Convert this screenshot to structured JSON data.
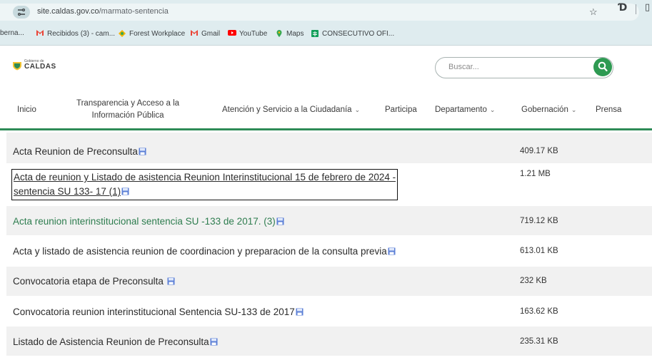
{
  "browser": {
    "url_host": "site.caldas.gov.co",
    "url_path": "/marmato-sentencia",
    "bookmarks": [
      {
        "label": "berna...",
        "icon": "none-icon"
      },
      {
        "label": "Recibidos (3) - cam...",
        "icon": "gmail-icon"
      },
      {
        "label": "Forest Workplace",
        "icon": "forest-icon"
      },
      {
        "label": "Gmail",
        "icon": "gmail-icon"
      },
      {
        "label": "YouTube",
        "icon": "youtube-icon"
      },
      {
        "label": "Maps",
        "icon": "maps-icon"
      },
      {
        "label": "CONSECUTIVO OFI...",
        "icon": "sheets-icon"
      }
    ]
  },
  "header": {
    "logo_small": "Gobierno de",
    "logo_big": "CALDAS",
    "search_placeholder": "Buscar..."
  },
  "nav": {
    "inicio": "Inicio",
    "transparencia_line1": "Transparencia y Acceso a la",
    "transparencia_line2": "Información Pública",
    "atencion": "Atención y Servicio a la Ciudadanía",
    "participa": "Participa",
    "departamento": "Departamento",
    "gobernacion": "Gobernación",
    "prensa": "Prensa"
  },
  "documents": [
    {
      "title": "Acta Reunion de Preconsulta",
      "size": "409.17 KB"
    },
    {
      "title_line1": "Acta de reunion y Listado de asistencia Reunion Interinstitucional 15 de febrero de 2024 -",
      "title_line2": "sentencia SU 133- 17 (1)",
      "size": "1.21 MB"
    },
    {
      "title": "Acta reunion interinstitucional sentencia SU -133 de 2017. (3)",
      "size": "719.12 KB"
    },
    {
      "title": "Acta y listado de asistencia reunion de coordinacion y preparacion de la consulta previa",
      "size": "613.01 KB"
    },
    {
      "title": "Convocatoria etapa de Preconsulta ",
      "size": "232 KB"
    },
    {
      "title": "Convocatoria reunion interinstitucional Sentencia SU-133 de 2017",
      "size": "163.62 KB"
    },
    {
      "title": "Listado de Asistencia Reunion de Preconsulta",
      "size": "235.31 KB"
    }
  ],
  "colors": {
    "accent_green": "#2e8b57",
    "search_button": "#2e9a52",
    "disk_icon": "#5b7fd6"
  }
}
